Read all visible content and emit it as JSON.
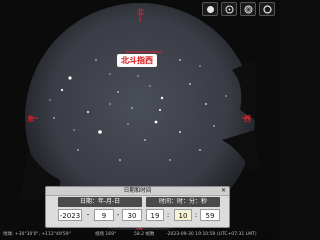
{
  "colors": {
    "horizon_red": "#d8222f",
    "sky": "#3b3f47",
    "ground": "#0a0a0a"
  },
  "toolbar": {
    "icons": [
      "filled-circle-icon",
      "circle-dot-icon",
      "target-icon",
      "ring-icon"
    ]
  },
  "compass": {
    "north": "北",
    "south": "南",
    "east": "东",
    "west": "西"
  },
  "label": {
    "text": "北斗指西"
  },
  "dialog": {
    "title": "日期和时间",
    "date_header": "日期：年-月-日",
    "time_header": "时间：时：分：秒",
    "year": "-2023",
    "month": "9",
    "day": "30",
    "hour": "19",
    "minute": "10",
    "second": "59",
    "sep_dash": "-",
    "sep_colon": ":"
  },
  "status": {
    "location": "地球, +30°30'0\", +112°49'59\"",
    "fov": "视场 169°",
    "fps": "58.2 帧数",
    "datetime": "-2023-09-30 19:10:59 (UTC+07:31 LMT)"
  }
}
